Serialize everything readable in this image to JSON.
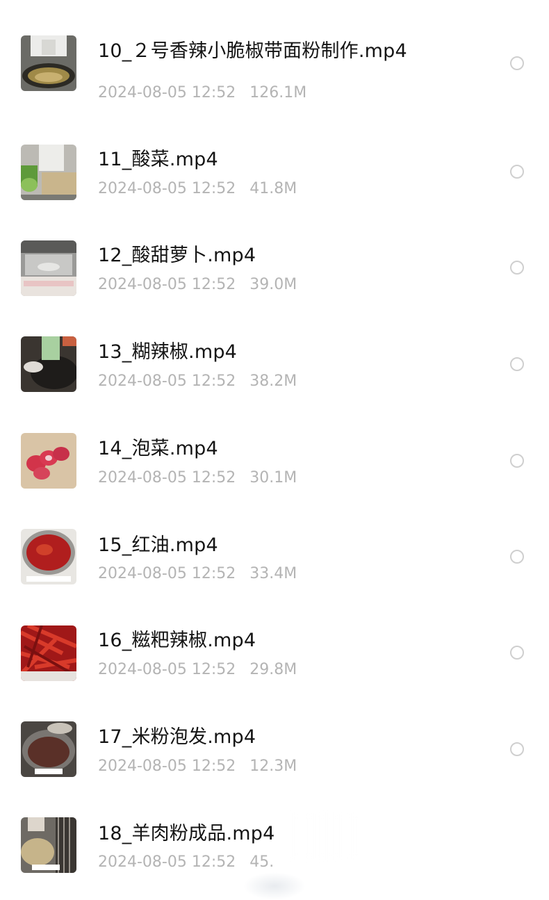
{
  "files": [
    {
      "name": "10_２号香辣小脆椒带面粉制作.mp4",
      "date": "2024-08-05 12:52",
      "size": "126.1M",
      "thumb_icon": "video-thumbnail-frying-wok"
    },
    {
      "name": "11_酸菜.mp4",
      "date": "2024-08-05 12:52",
      "size": "41.8M",
      "thumb_icon": "video-thumbnail-cutting-greens"
    },
    {
      "name": "12_酸甜萝卜.mp4",
      "date": "2024-08-05 12:52",
      "size": "39.0M",
      "thumb_icon": "video-thumbnail-steel-counter"
    },
    {
      "name": "13_糊辣椒.mp4",
      "date": "2024-08-05 12:52",
      "size": "38.2M",
      "thumb_icon": "video-thumbnail-wok-spices"
    },
    {
      "name": "14_泡菜.mp4",
      "date": "2024-08-05 12:52",
      "size": "30.1M",
      "thumb_icon": "video-thumbnail-sliced-radish"
    },
    {
      "name": "15_红油.mp4",
      "date": "2024-08-05 12:52",
      "size": "33.4M",
      "thumb_icon": "video-thumbnail-chili-oil"
    },
    {
      "name": "16_糍粑辣椒.mp4",
      "date": "2024-08-05 12:52",
      "size": "29.8M",
      "thumb_icon": "video-thumbnail-dried-chilies"
    },
    {
      "name": "17_米粉泡发.mp4",
      "date": "2024-08-05 12:52",
      "size": "12.3M",
      "thumb_icon": "video-thumbnail-soaking-noodles"
    },
    {
      "name": "18_羊肉粉成品.mp4",
      "date": "2024-08-05 12:52",
      "size": "45.",
      "thumb_icon": "video-thumbnail-mutton-noodles"
    }
  ],
  "colors": {
    "name_text": "#141414",
    "meta_text": "#b4b4b4",
    "radio_border": "#cfcfcf"
  }
}
